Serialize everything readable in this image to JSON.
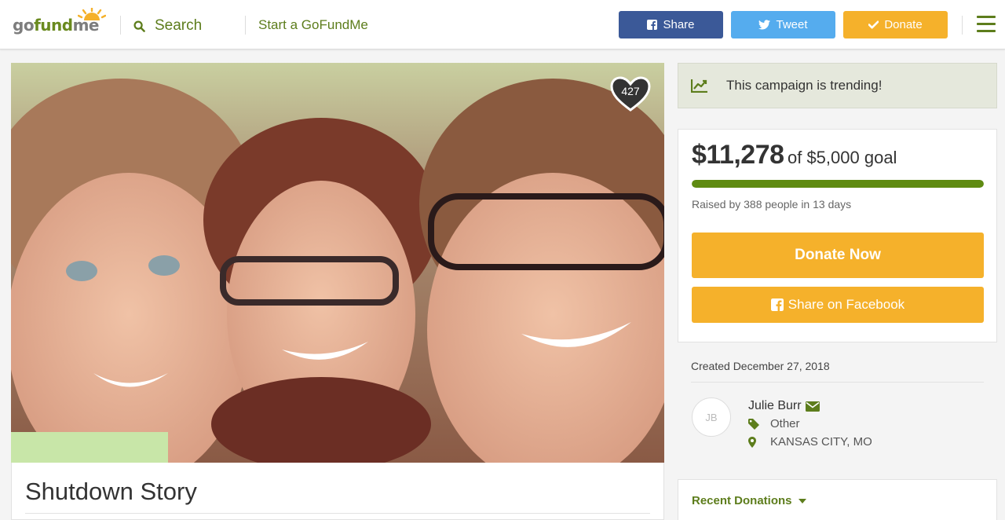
{
  "header": {
    "logo": {
      "part1": "go",
      "part2": "fund",
      "part3": "me"
    },
    "search_label": "Search",
    "start_link": "Start a GoFundMe",
    "share_label": "Share",
    "tweet_label": "Tweet",
    "donate_label": "Donate"
  },
  "campaign": {
    "title": "Shutdown Story",
    "hearts": "427",
    "trending_text": "This campaign is trending!",
    "raised_amount": "$11,278",
    "goal_text": "of $5,000 goal",
    "progress_fraction": 1.0,
    "raised_by": "Raised by 388 people in 13 days",
    "donate_now_label": "Donate Now",
    "share_facebook_label": "Share on Facebook",
    "created": "Created December 27, 2018",
    "organizer": {
      "initials": "JB",
      "name": "Julie Burr",
      "category": "Other",
      "location": "KANSAS CITY, MO"
    },
    "recent_donations_label": "Recent Donations"
  },
  "colors": {
    "brand_green": "#5d7d1c",
    "donate_orange": "#f5b12b",
    "facebook_blue": "#3b5998",
    "twitter_blue": "#55acee",
    "progress_green": "#5f8b12"
  }
}
